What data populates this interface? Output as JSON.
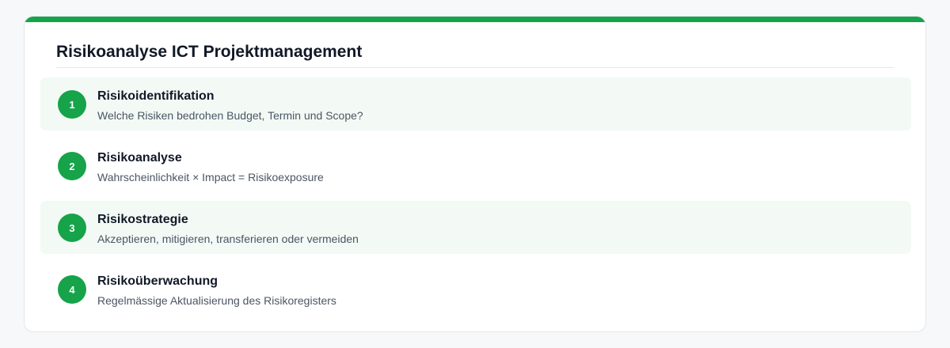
{
  "title": "Risikoanalyse ICT Projektmanagement",
  "colors": {
    "accent": "#16a34a",
    "shaded_row": "#f3faf5"
  },
  "steps": [
    {
      "number": "1",
      "heading": "Risikoidentifikation",
      "description": "Welche Risiken bedrohen Budget, Termin und Scope?"
    },
    {
      "number": "2",
      "heading": "Risikoanalyse",
      "description": "Wahrscheinlichkeit × Impact = Risikoexposure"
    },
    {
      "number": "3",
      "heading": "Risikostrategie",
      "description": "Akzeptieren, mitigieren, transferieren oder vermeiden"
    },
    {
      "number": "4",
      "heading": "Risikoüberwachung",
      "description": "Regelmässige Aktualisierung des Risikoregisters"
    }
  ]
}
